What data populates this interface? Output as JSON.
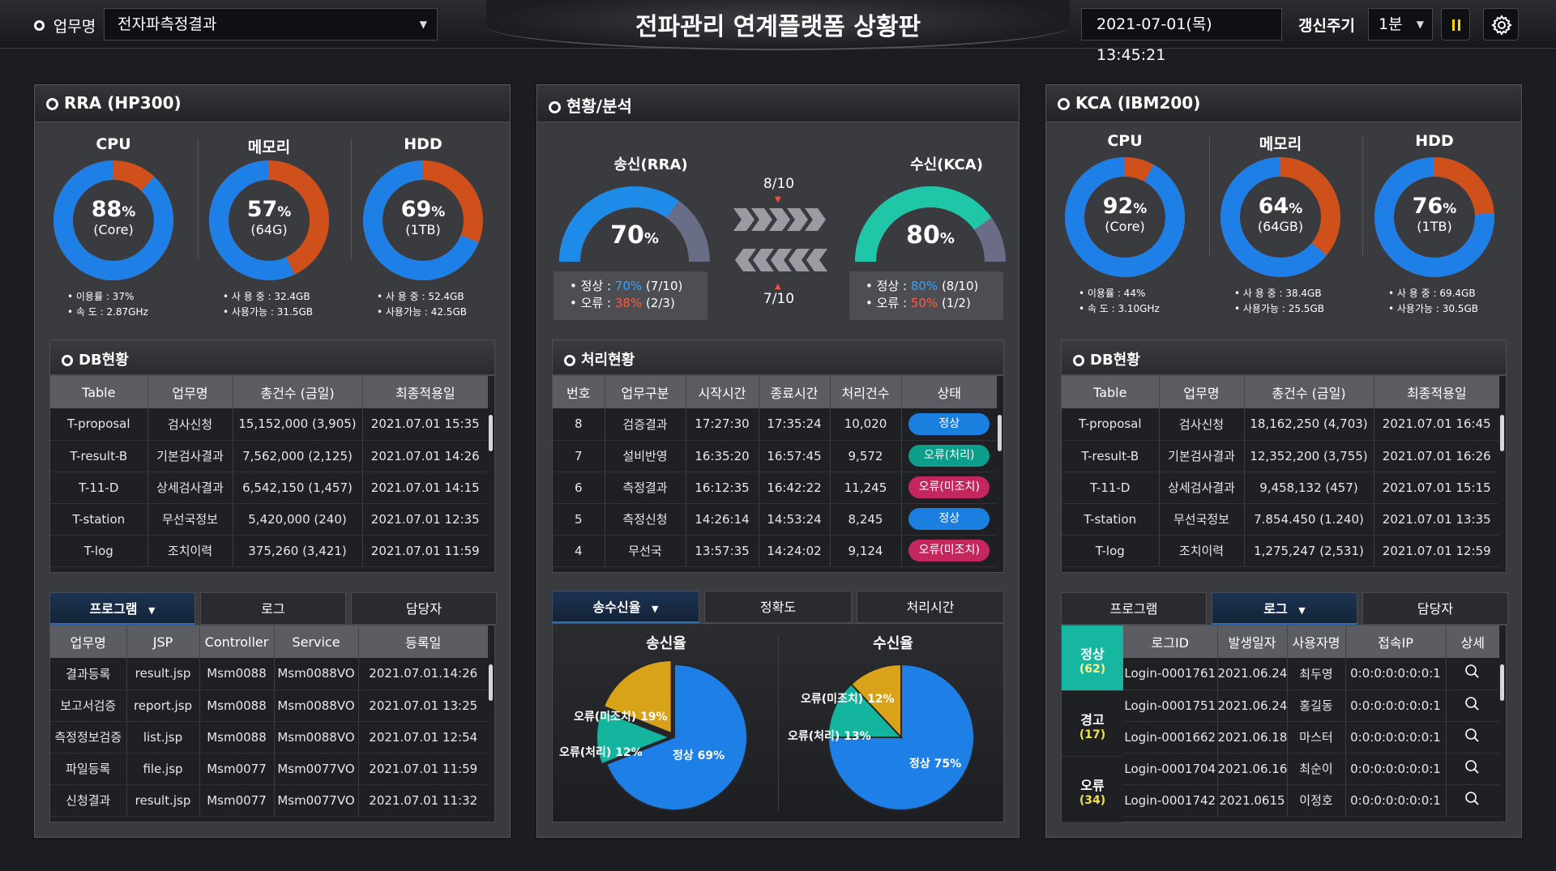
{
  "header": {
    "task_label": "업무명",
    "task_value": "전자파측정결과",
    "title": "전파관리 연계플랫폼 상황판",
    "datetime": "2021-07-01(목) 13:45:21",
    "refresh_label": "갱신주기",
    "refresh_value": "1분",
    "pause_icon": "pause-icon",
    "settings_icon": "gear-icon"
  },
  "rra": {
    "title": "RRA (HP300)",
    "metrics": [
      {
        "label": "CPU",
        "percent": 88,
        "sub": "(Core)",
        "line1": "• 이용률 : 37%",
        "line2": "• 속    도 : 2.87GHz"
      },
      {
        "label": "메모리",
        "percent": 57,
        "sub": "(64G)",
        "line1": "• 사 용 중 : 32.4GB",
        "line2": "• 사용가능 : 31.5GB"
      },
      {
        "label": "HDD",
        "percent": 69,
        "sub": "(1TB)",
        "line1": "• 사 용 중 : 52.4GB",
        "line2": "• 사용가능 : 42.5GB"
      }
    ],
    "db": {
      "title": "DB현황",
      "headers": [
        "Table",
        "업무명",
        "총건수 (금일)",
        "최종적용일"
      ],
      "rows": [
        [
          "T-proposal",
          "검사신청",
          "15,152,000 (3,905)",
          "2021.07.01 15:35"
        ],
        [
          "T-result-B",
          "기본검사결과",
          "7,562,000 (2,125)",
          "2021.07.01 14:26"
        ],
        [
          "T-11-D",
          "상세검사결과",
          "6,542,150 (1,457)",
          "2021.07.01 14:15"
        ],
        [
          "T-station",
          "무선국정보",
          "5,420,000 (240)",
          "2021.07.01 12:35"
        ],
        [
          "T-log",
          "조치이력",
          "375,260 (3,421)",
          "2021.07.01 11:59"
        ]
      ]
    },
    "tabs": [
      "프로그램",
      "로그",
      "담당자"
    ],
    "program": {
      "headers": [
        "업무명",
        "JSP",
        "Controller",
        "Service",
        "등록일"
      ],
      "rows": [
        [
          "결과등록",
          "result.jsp",
          "Msm0088",
          "Msm0088VO",
          "2021.07.01.14:26"
        ],
        [
          "보고서검증",
          "report.jsp",
          "Msm0088",
          "Msm0088VO",
          "2021.07.01 13:25"
        ],
        [
          "측정정보검증",
          "list.jsp",
          "Msm0088",
          "Msm0088VO",
          "2021.07.01 12:54"
        ],
        [
          "파일등록",
          "file.jsp",
          "Msm0077",
          "Msm0077VO",
          "2021.07.01 11:59"
        ],
        [
          "신청결과",
          "result.jsp",
          "Msm0077",
          "Msm0077VO",
          "2021.07.01 11:32"
        ]
      ]
    }
  },
  "center": {
    "title": "현황/분석",
    "send": {
      "label": "송신(RRA)",
      "percent": 70,
      "ok_label": "• 정상 :",
      "ok_pct": "70%",
      "ok_count": "(7/10)",
      "err_label": "• 오류 :",
      "err_pct": "38%",
      "err_count": "(2/3)"
    },
    "recv": {
      "label": "수신(KCA)",
      "percent": 80,
      "ok_label": "• 정상 :",
      "ok_pct": "80%",
      "ok_count": "(8/10)",
      "err_label": "• 오류 :",
      "err_pct": "50%",
      "err_count": "(1/2)"
    },
    "ratio_top": "8/10",
    "ratio_bottom": "7/10",
    "process": {
      "title": "처리현황",
      "headers": [
        "번호",
        "업무구분",
        "시작시간",
        "종료시간",
        "처리건수",
        "상태"
      ],
      "rows": [
        [
          "8",
          "검증결과",
          "17:27:30",
          "17:35:24",
          "10,020",
          "정상"
        ],
        [
          "7",
          "설비반영",
          "16:35:20",
          "16:57:45",
          "9,572",
          "오류(처리)"
        ],
        [
          "6",
          "측정결과",
          "16:12:35",
          "16:42:22",
          "11,245",
          "오류(미조치)"
        ],
        [
          "5",
          "측정신청",
          "14:26:14",
          "14:53:24",
          "8,245",
          "정상"
        ],
        [
          "4",
          "무선국",
          "13:57:35",
          "14:24:02",
          "9,124",
          "오류(미조치)"
        ]
      ]
    },
    "tabs": [
      "송수신율",
      "정확도",
      "처리시간"
    ]
  },
  "chart_data": [
    {
      "type": "pie",
      "title": "송신율",
      "categories": [
        "정상",
        "오류(처리)",
        "오류(미조치)"
      ],
      "values": [
        69,
        12,
        19
      ],
      "labels": [
        "정상 69%",
        "오류(처리) 12%",
        "오류(미조치) 19%"
      ],
      "colors": [
        "#1e7fe6",
        "#13b59e",
        "#d9a319"
      ]
    },
    {
      "type": "pie",
      "title": "수신율",
      "categories": [
        "정상",
        "오류(처리)",
        "오류(미조치)"
      ],
      "values": [
        75,
        13,
        12
      ],
      "labels": [
        "정상 75%",
        "오류(처리) 13%",
        "오류(미조치) 12%"
      ],
      "colors": [
        "#1e7fe6",
        "#13b59e",
        "#d9a319"
      ]
    }
  ],
  "kca": {
    "title": "KCA (IBM200)",
    "metrics": [
      {
        "label": "CPU",
        "percent": 92,
        "sub": "(Core)",
        "line1": "• 이용률 : 44%",
        "line2": "• 속    도 : 3.10GHz"
      },
      {
        "label": "메모리",
        "percent": 64,
        "sub": "(64GB)",
        "line1": "• 사 용 중 : 38.4GB",
        "line2": "• 사용가능 : 25.5GB"
      },
      {
        "label": "HDD",
        "percent": 76,
        "sub": "(1TB)",
        "line1": "• 사 용 중 : 69.4GB",
        "line2": "• 사용가능 : 30.5GB"
      }
    ],
    "db": {
      "title": "DB현황",
      "headers": [
        "Table",
        "업무명",
        "총건수 (금일)",
        "최종적용일"
      ],
      "rows": [
        [
          "T-proposal",
          "검사신청",
          "18,162,250 (4,703)",
          "2021.07.01 16:45"
        ],
        [
          "T-result-B",
          "기본검사결과",
          "12,352,200 (3,755)",
          "2021.07.01 16:26"
        ],
        [
          "T-11-D",
          "상세검사결과",
          "9,458,132 (457)",
          "2021.07.01 15:15"
        ],
        [
          "T-station",
          "무선국정보",
          "7.854.450 (1.240)",
          "2021.07.01 13:35"
        ],
        [
          "T-log",
          "조치이력",
          "1,275,247 (2,531)",
          "2021.07.01 12:59"
        ]
      ]
    },
    "tabs": [
      "프로그램",
      "로그",
      "담당자"
    ],
    "log_status": [
      {
        "label": "정상",
        "count": "(62)"
      },
      {
        "label": "경고",
        "count": "(17)"
      },
      {
        "label": "오류",
        "count": "(34)"
      }
    ],
    "log": {
      "headers": [
        "로그ID",
        "발생일자",
        "사용자명",
        "접속IP",
        "상세"
      ],
      "rows": [
        [
          "Login-0001761",
          "2021.06.24",
          "최두영",
          "0:0:0:0:0:0:0:1"
        ],
        [
          "Login-0001751",
          "2021.06.24",
          "홍길동",
          "0:0:0:0:0:0:0:1"
        ],
        [
          "Login-0001662",
          "2021.06.18",
          "마스터",
          "0:0:0:0:0:0:0:1"
        ],
        [
          "Login-0001704",
          "2021.06.16",
          "최순이",
          "0:0:0:0:0:0:0:1"
        ],
        [
          "Login-0001742",
          "2021.0615",
          "이정호",
          "0:0:0:0:0:0:0:1"
        ]
      ]
    }
  },
  "colors": {
    "donut_used": "#1e7fe6",
    "donut_rest": "#d0501c",
    "gauge_send": "#1f8be8",
    "gauge_recv": "#1fc7a8",
    "gauge_rest": "#6a6d86"
  }
}
